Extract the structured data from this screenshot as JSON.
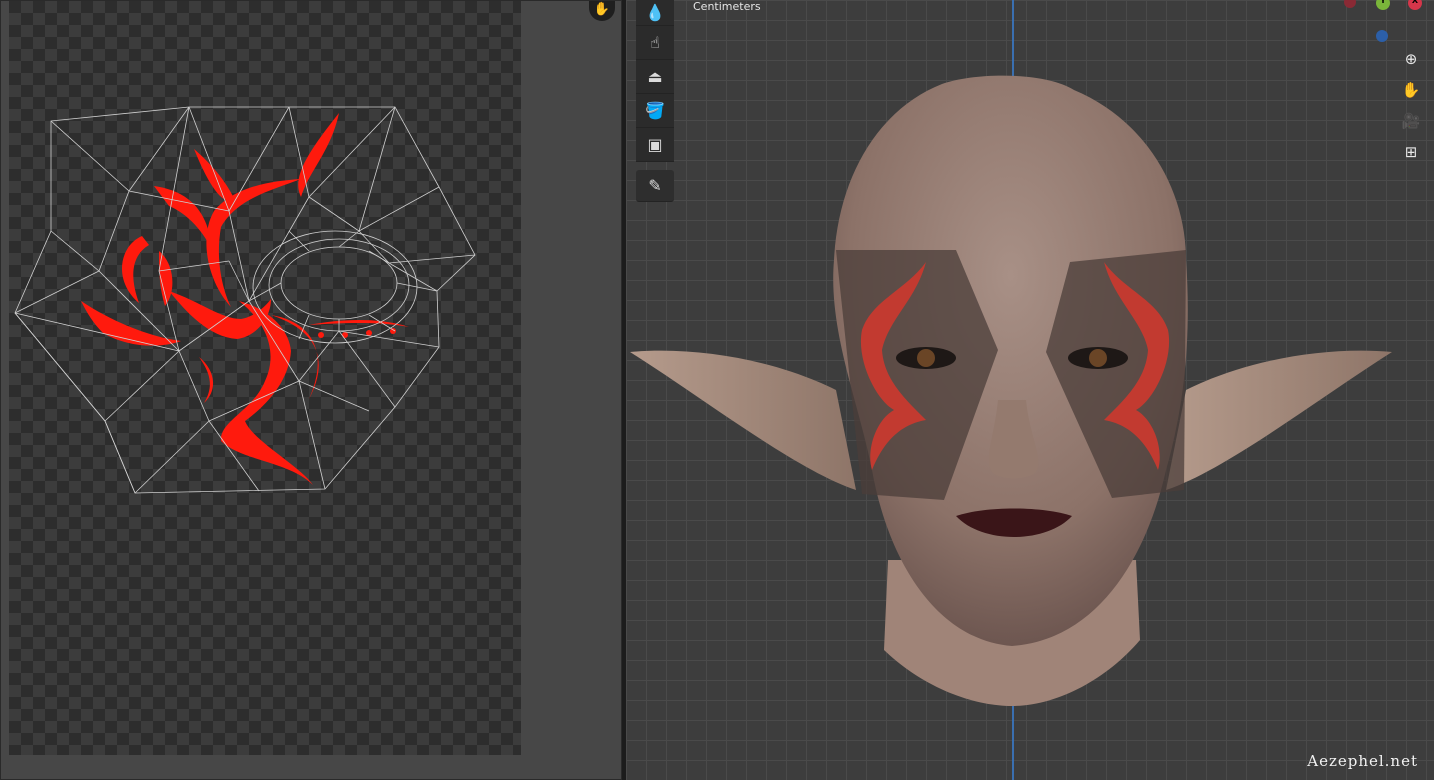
{
  "viewport": {
    "units_label": "Centimeters",
    "watermark": "Aezephel.net",
    "axis_color": "#3a6fb0"
  },
  "uv_editor": {
    "hand_icon": "hand-icon",
    "paint_color": "#ff1a0d"
  },
  "toolbar": {
    "tools": [
      {
        "icon": "drop-icon",
        "glyph": "💧"
      },
      {
        "icon": "smear-icon",
        "glyph": "☝"
      },
      {
        "icon": "clone-stamp-icon",
        "glyph": "⏏"
      },
      {
        "icon": "fill-bucket-icon",
        "glyph": "🪣"
      },
      {
        "icon": "mask-icon",
        "glyph": "▣"
      },
      {
        "icon": "annotate-icon",
        "glyph": "✎"
      }
    ]
  },
  "nav": {
    "zoom": "⊕",
    "pan": "✋",
    "camera": "🎥",
    "grid": "⊞"
  },
  "gizmo": {
    "y_label": "Y",
    "x_label": "X"
  }
}
